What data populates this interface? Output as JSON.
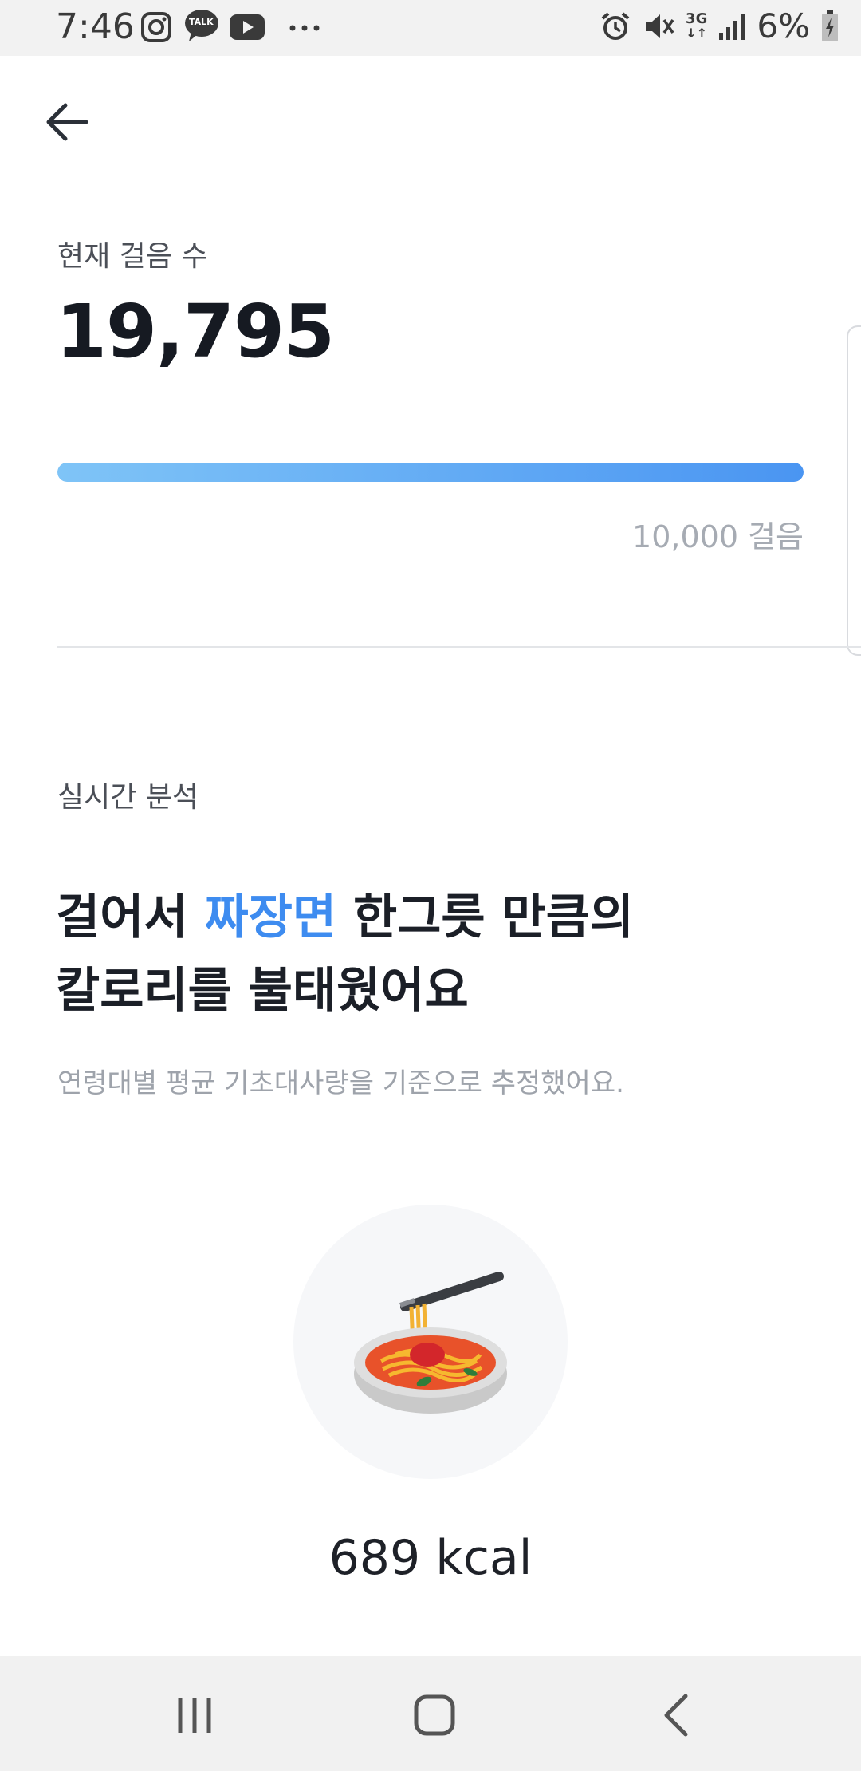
{
  "status_bar": {
    "time": "7:46",
    "left_icons": [
      "instagram-icon",
      "kakaotalk-icon",
      "youtube-icon",
      "more-dots-icon"
    ],
    "talk_badge": "TALK",
    "network": "3G",
    "battery": "6%",
    "right_icons": [
      "alarm-icon",
      "mute-icon",
      "signal-icon",
      "battery-charging-icon"
    ]
  },
  "header": {
    "back_icon": "arrow-left-icon"
  },
  "steps": {
    "label": "현재 걸음 수",
    "value": "19,795",
    "goal": "10,000 걸음",
    "progress": 1.0
  },
  "analysis": {
    "label": "실시간 분석",
    "headline_prefix": "걸어서 ",
    "headline_food": "짜장면",
    "headline_suffix": " 한그릇 만큼의",
    "headline_line2": "칼로리를 불태웠어요",
    "note": "연령대별 평균 기초대사량을 기준으로 추정했어요.",
    "food_icon": "noodle-bowl-icon",
    "kcal": "689 kcal"
  },
  "colors": {
    "accent": "#3e8cf0",
    "progress_start": "#7fc4f7",
    "progress_end": "#4a95f2"
  },
  "nav_bar": {
    "icons": [
      "recent-apps-icon",
      "home-icon",
      "back-icon"
    ]
  }
}
